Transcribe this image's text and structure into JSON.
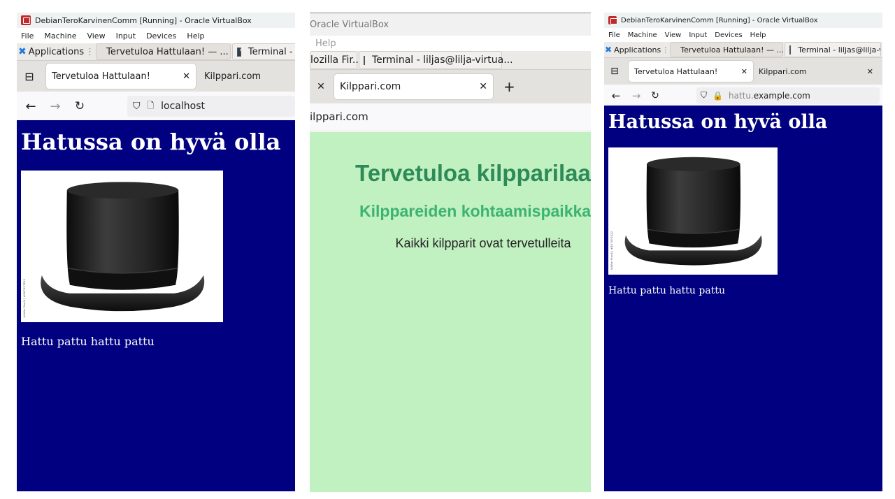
{
  "left": {
    "vb_title": "DebianTeroKarvinenComm [Running] - Oracle VirtualBox",
    "vb_menu": [
      "File",
      "Machine",
      "View",
      "Input",
      "Devices",
      "Help"
    ],
    "taskbar": {
      "applications": "Applications",
      "firefox_task": "Tervetuloa Hattulaan! — ...",
      "terminal_task": "Terminal - lilja"
    },
    "tabs": {
      "active": "Tervetuloa Hattulaan!",
      "other": "Kilppari.com"
    },
    "url": "localhost",
    "page": {
      "heading": "Hatussa on hyvä olla",
      "caption": "Hattu pattu hattu pattu",
      "watermark": "Adobe Stock | #467851432"
    }
  },
  "middle": {
    "vb_title": "Oracle VirtualBox",
    "vb_menu_help": "Help",
    "taskbar": {
      "firefox_task": "lozilla Fir...",
      "terminal_task": "Terminal - liljas@lilja-virtua..."
    },
    "tabs": {
      "active": "Kilppari.com",
      "new_tab": "+"
    },
    "url": "ilppari.com",
    "page": {
      "h1": "Tervetuloa kilpparilaan",
      "h2": "Kilppareiden kohtaamispaikka",
      "p": "Kaikki kilpparit ovat tervetulleita"
    }
  },
  "right": {
    "vb_title": "DebianTeroKarvinenComm [Running] - Oracle VirtualBox",
    "vb_menu": [
      "File",
      "Machine",
      "View",
      "Input",
      "Devices",
      "Help"
    ],
    "taskbar": {
      "applications": "Applications",
      "firefox_task": "Tervetuloa Hattulaan! — ...",
      "terminal_task": "Terminal - liljas@lilja-virtua..."
    },
    "tabs": {
      "active": "Tervetuloa Hattulaan!",
      "other": "Kilppari.com"
    },
    "url": {
      "prefix": "hattu.",
      "domain": "example.com"
    },
    "page": {
      "heading": "Hatussa on hyvä olla",
      "caption": "Hattu pattu hattu pattu",
      "watermark": "Adobe Stock | #467851432"
    }
  },
  "colors": {
    "hattu_bg": "#000080",
    "kilppari_bg": "#c1f0c1",
    "kilppari_h1": "#2e8b57",
    "kilppari_h2": "#3cb371"
  }
}
